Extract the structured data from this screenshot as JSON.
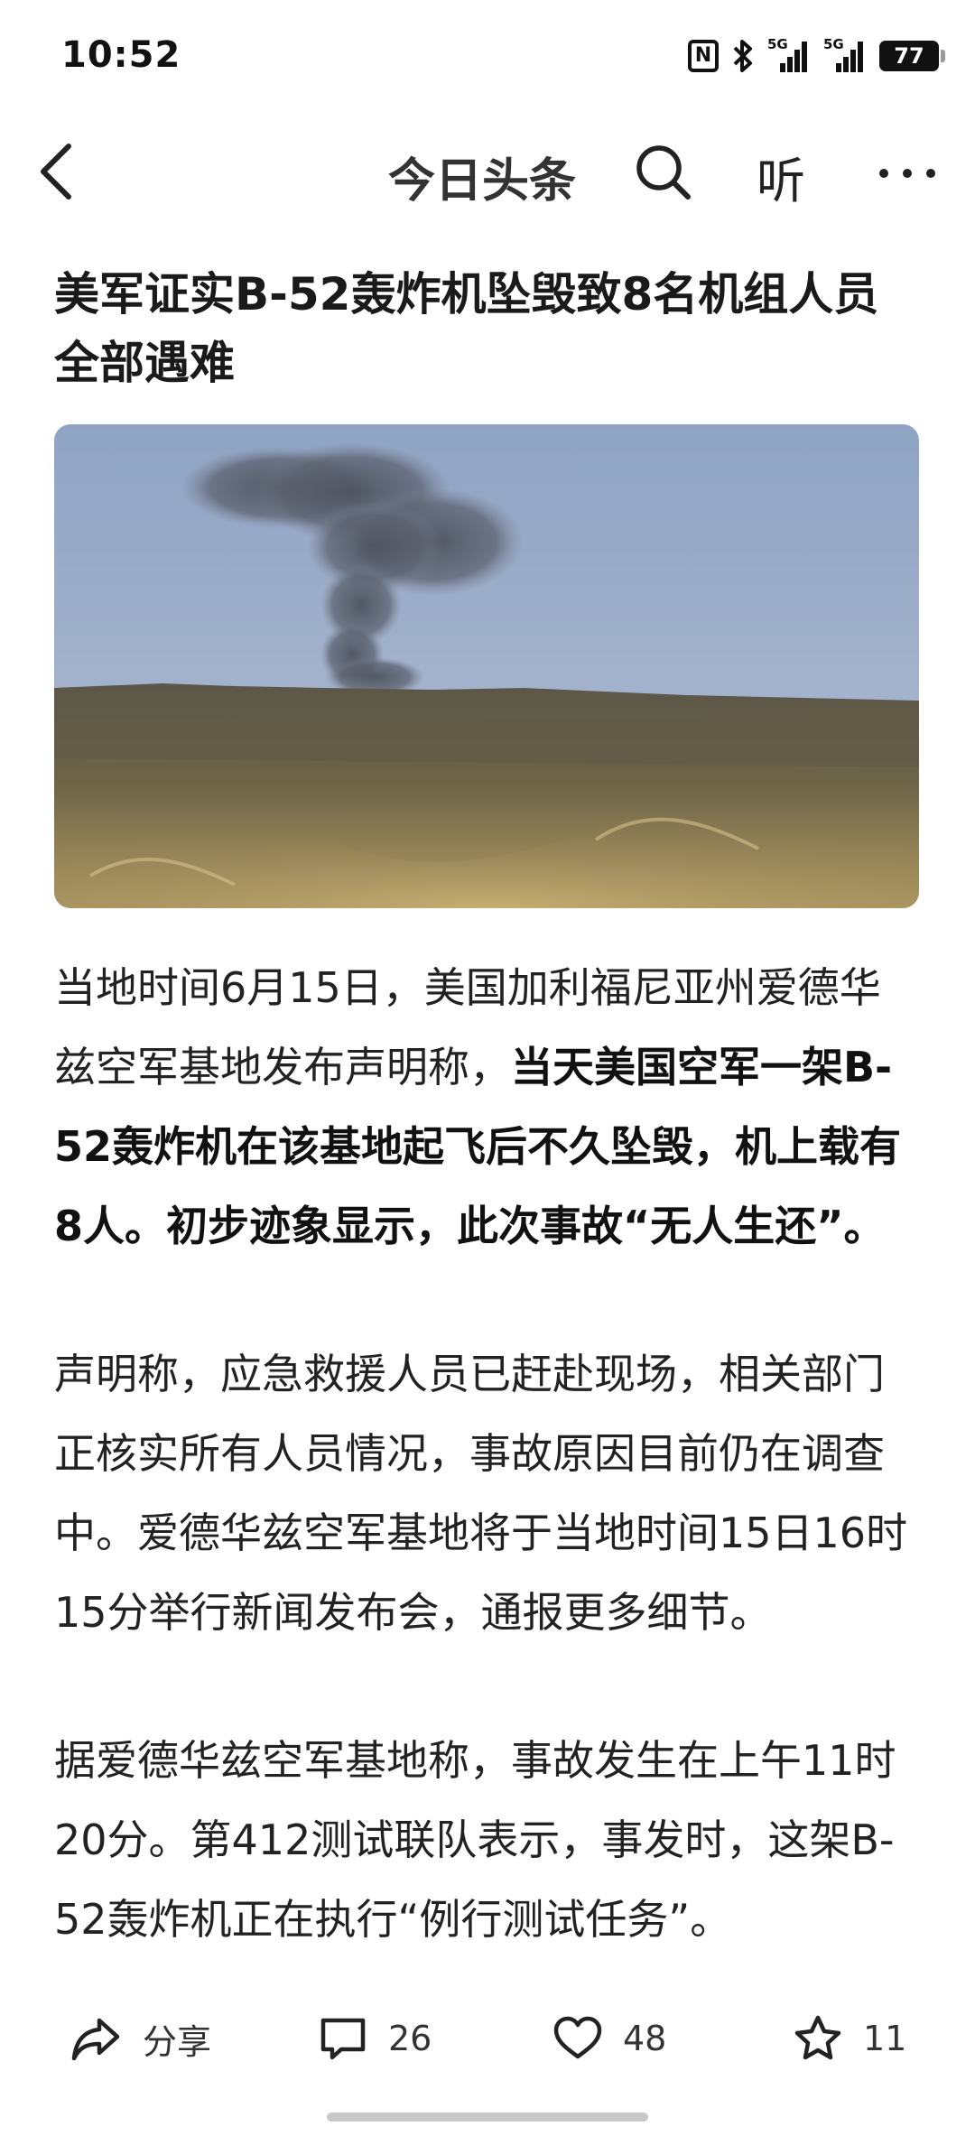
{
  "status_bar": {
    "time": "10:52",
    "battery": "77",
    "signal1_label": "5G",
    "signal2_label": "5G",
    "nfc_label": "N"
  },
  "nav": {
    "title": "今日头条",
    "listen_label": "听"
  },
  "article": {
    "title": "美军证实B-52轰炸机坠毁致8名机组人员全部遇难",
    "paragraphs": [
      {
        "before": "当地时间6月15日，美国加利福尼亚州爱德华兹空军基地发布声明称，",
        "bold": "当天美国空军一架B-52轰炸机在该基地起飞后不久坠毁，机上载有8人。初步迹象显示，此次事故“无人生还”。",
        "after": ""
      },
      {
        "text": "声明称，应急救援人员已赶赴现场，相关部门正核实所有人员情况，事故原因目前仍在调查中。爱德华兹空军基地将于当地时间15日16时15分举行新闻发布会，通报更多细节。"
      },
      {
        "text": "据爱德华兹空军基地称，事故发生在上午11时20分。第412测试联队表示，事发时，这架B-52轰炸机正在执行“例行测试任务”。"
      }
    ]
  },
  "actions": {
    "share_label": "分享",
    "comments": "26",
    "likes": "48",
    "favorites": "11"
  },
  "icons": {
    "back": "chevron-left-icon",
    "search": "search-icon",
    "more": "more-dots-icon",
    "share": "share-arrow-icon",
    "comment": "comment-bubble-icon",
    "like": "heart-icon",
    "favorite": "star-icon"
  }
}
